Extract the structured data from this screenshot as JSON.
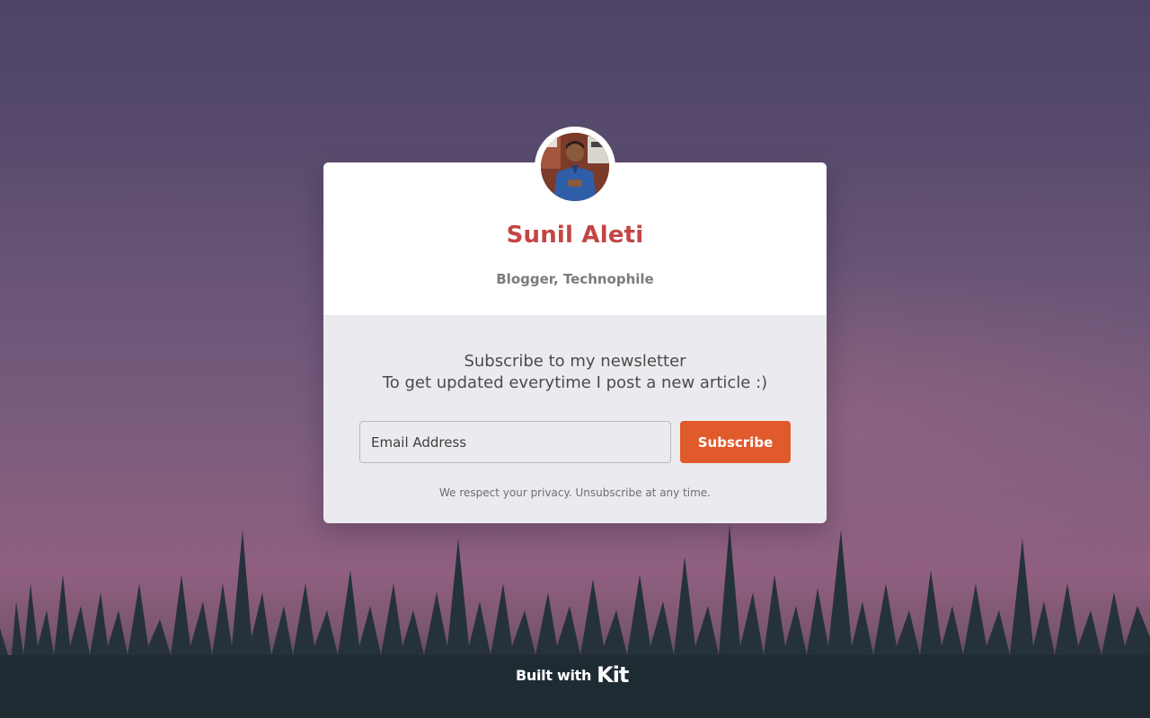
{
  "author": {
    "name": "Sunil Aleti",
    "title": "Blogger, Technophile"
  },
  "newsletter": {
    "headline_line1": "Subscribe to my newsletter",
    "headline_line2": "To get updated everytime I post a new article :)",
    "email_placeholder": "Email Address",
    "subscribe_label": "Subscribe",
    "privacy_note": "We respect your privacy. Unsubscribe at any time."
  },
  "footer": {
    "built_with": "Built with",
    "brand": "Kit"
  },
  "colors": {
    "name": "#c44545",
    "button": "#e05a2c"
  }
}
